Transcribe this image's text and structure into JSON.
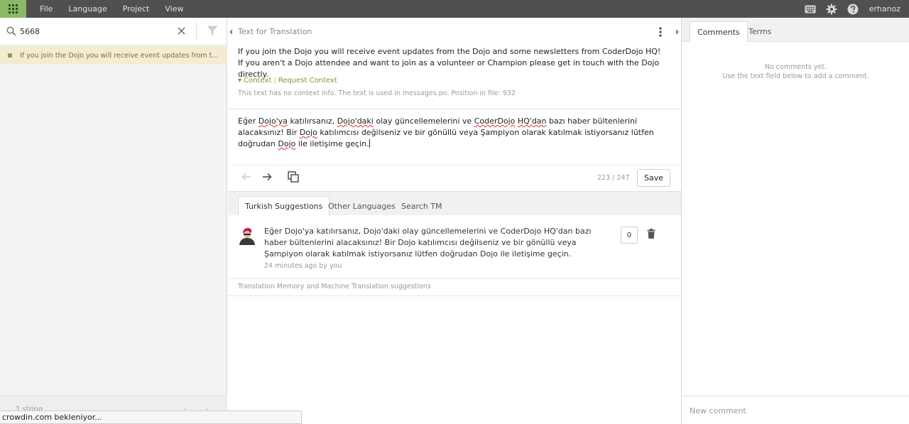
{
  "topbar": {
    "menu": [
      "File",
      "Language",
      "Project",
      "View"
    ],
    "user_name": "erhanoz"
  },
  "search": {
    "value": "5668"
  },
  "strings": [
    {
      "text": "If you join the Dojo you will receive event updates from the Dojo and some newsletters from CoderDojo HQ!",
      "status_color": "#7fa64f"
    }
  ],
  "left_footer": {
    "string_count": "1 string"
  },
  "status_bar": {
    "text": "crowdin.com bekleniyor..."
  },
  "source": {
    "header": "Text for Translation",
    "text": "If you join the Dojo you will receive event updates from the Dojo and some newsletters from CoderDojo HQ! If you aren't a Dojo attendee and want to join as a volunteer or Champion please get in touch with the Dojo directly.",
    "context_label": "Context",
    "request_context_label": "Request Context",
    "context_info": "This text has no context info. The text is used in messages.po. Position in file: 932"
  },
  "translation": {
    "parts": [
      "Eğer ",
      "Dojo'ya",
      " katılırsanız, ",
      "Dojo'daki",
      " olay güncellemelerini ve ",
      "CoderDojo",
      " ",
      "HQ'dan",
      " bazı haber bültenlerini alacaksınız! Bir ",
      "Dojo",
      " katılımcısı değilseniz ve bir gönüllü veya Şampiyon olarak katılmak istiyorsanız lütfen doğrudan ",
      "Dojo",
      " ile iletişime geçin."
    ],
    "char_count": "223 / 247",
    "save_label": "Save"
  },
  "suggestion_tabs": [
    "Turkish Suggestions",
    "Other Languages",
    "Search TM"
  ],
  "suggestion": {
    "text": "Eğer Dojo'ya katılırsanız, Dojo'daki olay güncellemelerini ve CoderDojo HQ'dan bazı haber bültenlerini alacaksınız! Bir Dojo katılımcısı değilseniz ve bir gönüllü veya Şampiyon olarak katılmak istiyorsanız lütfen doğrudan Dojo ile iletişime geçin.",
    "meta": "24 minutes ago by you",
    "votes": "0"
  },
  "tm_label": "Translation Memory and Machine Translation suggestions",
  "comments": {
    "tabs": [
      "Comments",
      "Terms"
    ],
    "empty_line1": "No comments yet.",
    "empty_line2": "Use the text field below to add a comment.",
    "placeholder": "New comment"
  },
  "colors": {
    "topbar": "#505050",
    "apps_button": "#8ab867",
    "accent_green": "#7a9a3a",
    "selected_string_bg": "#f4ecd2"
  }
}
